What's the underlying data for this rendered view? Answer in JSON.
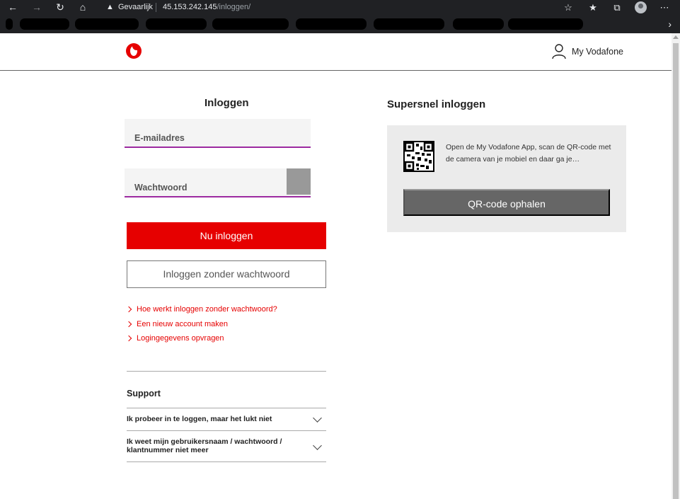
{
  "browser": {
    "security_label": "Gevaarlijk",
    "url_host": "45.153.242.145",
    "url_path": "/inloggen/"
  },
  "header": {
    "account_label": "My Vodafone"
  },
  "login": {
    "title": "Inloggen",
    "email_label": "E-mailadres",
    "password_label": "Wachtwoord",
    "primary_button": "Nu inloggen",
    "secondary_button": "Inloggen zonder wachtwoord",
    "links": [
      "Hoe werkt inloggen zonder wachtwoord?",
      "Een nieuw account maken",
      "Logingegevens opvragen"
    ]
  },
  "support": {
    "title": "Support",
    "items": [
      "Ik probeer in te loggen, maar het lukt niet",
      "Ik weet mijn gebruikersnaam / wachtwoord / klantnummer niet meer"
    ]
  },
  "quick_login": {
    "title": "Supersnel inloggen",
    "description": "Open de My Vodafone App, scan de QR-code met de camera van je mobiel en daar ga je…",
    "button": "QR-code ophalen"
  },
  "colors": {
    "brand_red": "#e60000",
    "field_underline": "#9c2aa0"
  }
}
